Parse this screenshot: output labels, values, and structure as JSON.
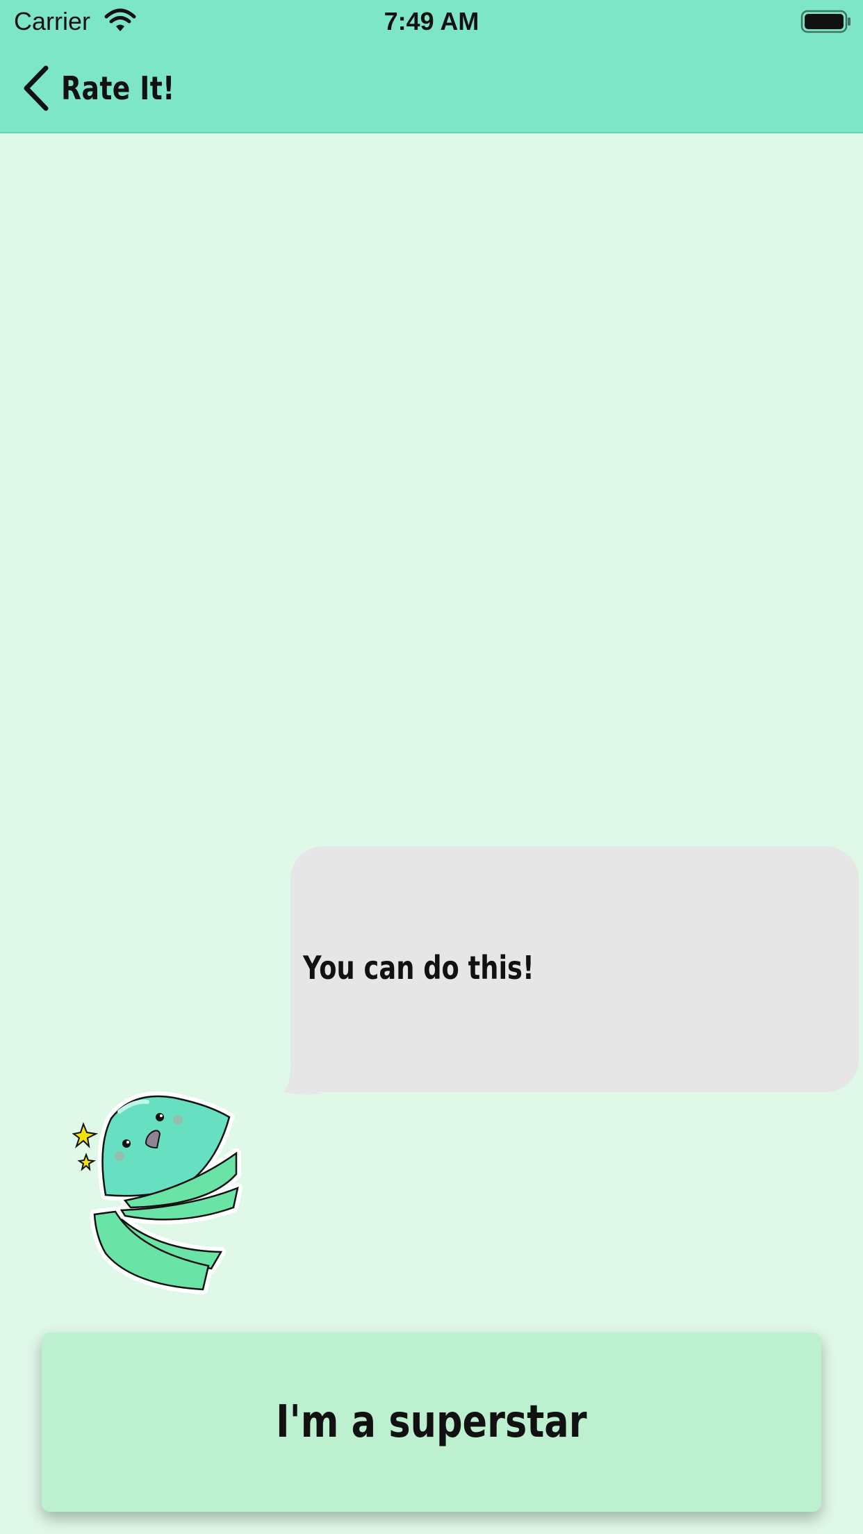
{
  "status_bar": {
    "carrier": "Carrier",
    "time": "7:49 AM",
    "wifi_icon": "wifi-icon",
    "battery_icon": "battery-full-icon"
  },
  "nav": {
    "back_icon": "chevron-left-icon",
    "title": "Rate It!"
  },
  "message": {
    "text": "You can do this!"
  },
  "mascot": {
    "icon": "mascot-character-illustration"
  },
  "action": {
    "button_label": "I'm a superstar"
  },
  "colors": {
    "header_background": "#7de6c7",
    "page_background": "#e0f8e8",
    "bubble_background": "#e6e6e6",
    "button_background": "#bcf0cf",
    "mascot_body": "#66e0c0",
    "mascot_stripes": "#6ae4a6",
    "sparkle": "#f2e20a"
  }
}
